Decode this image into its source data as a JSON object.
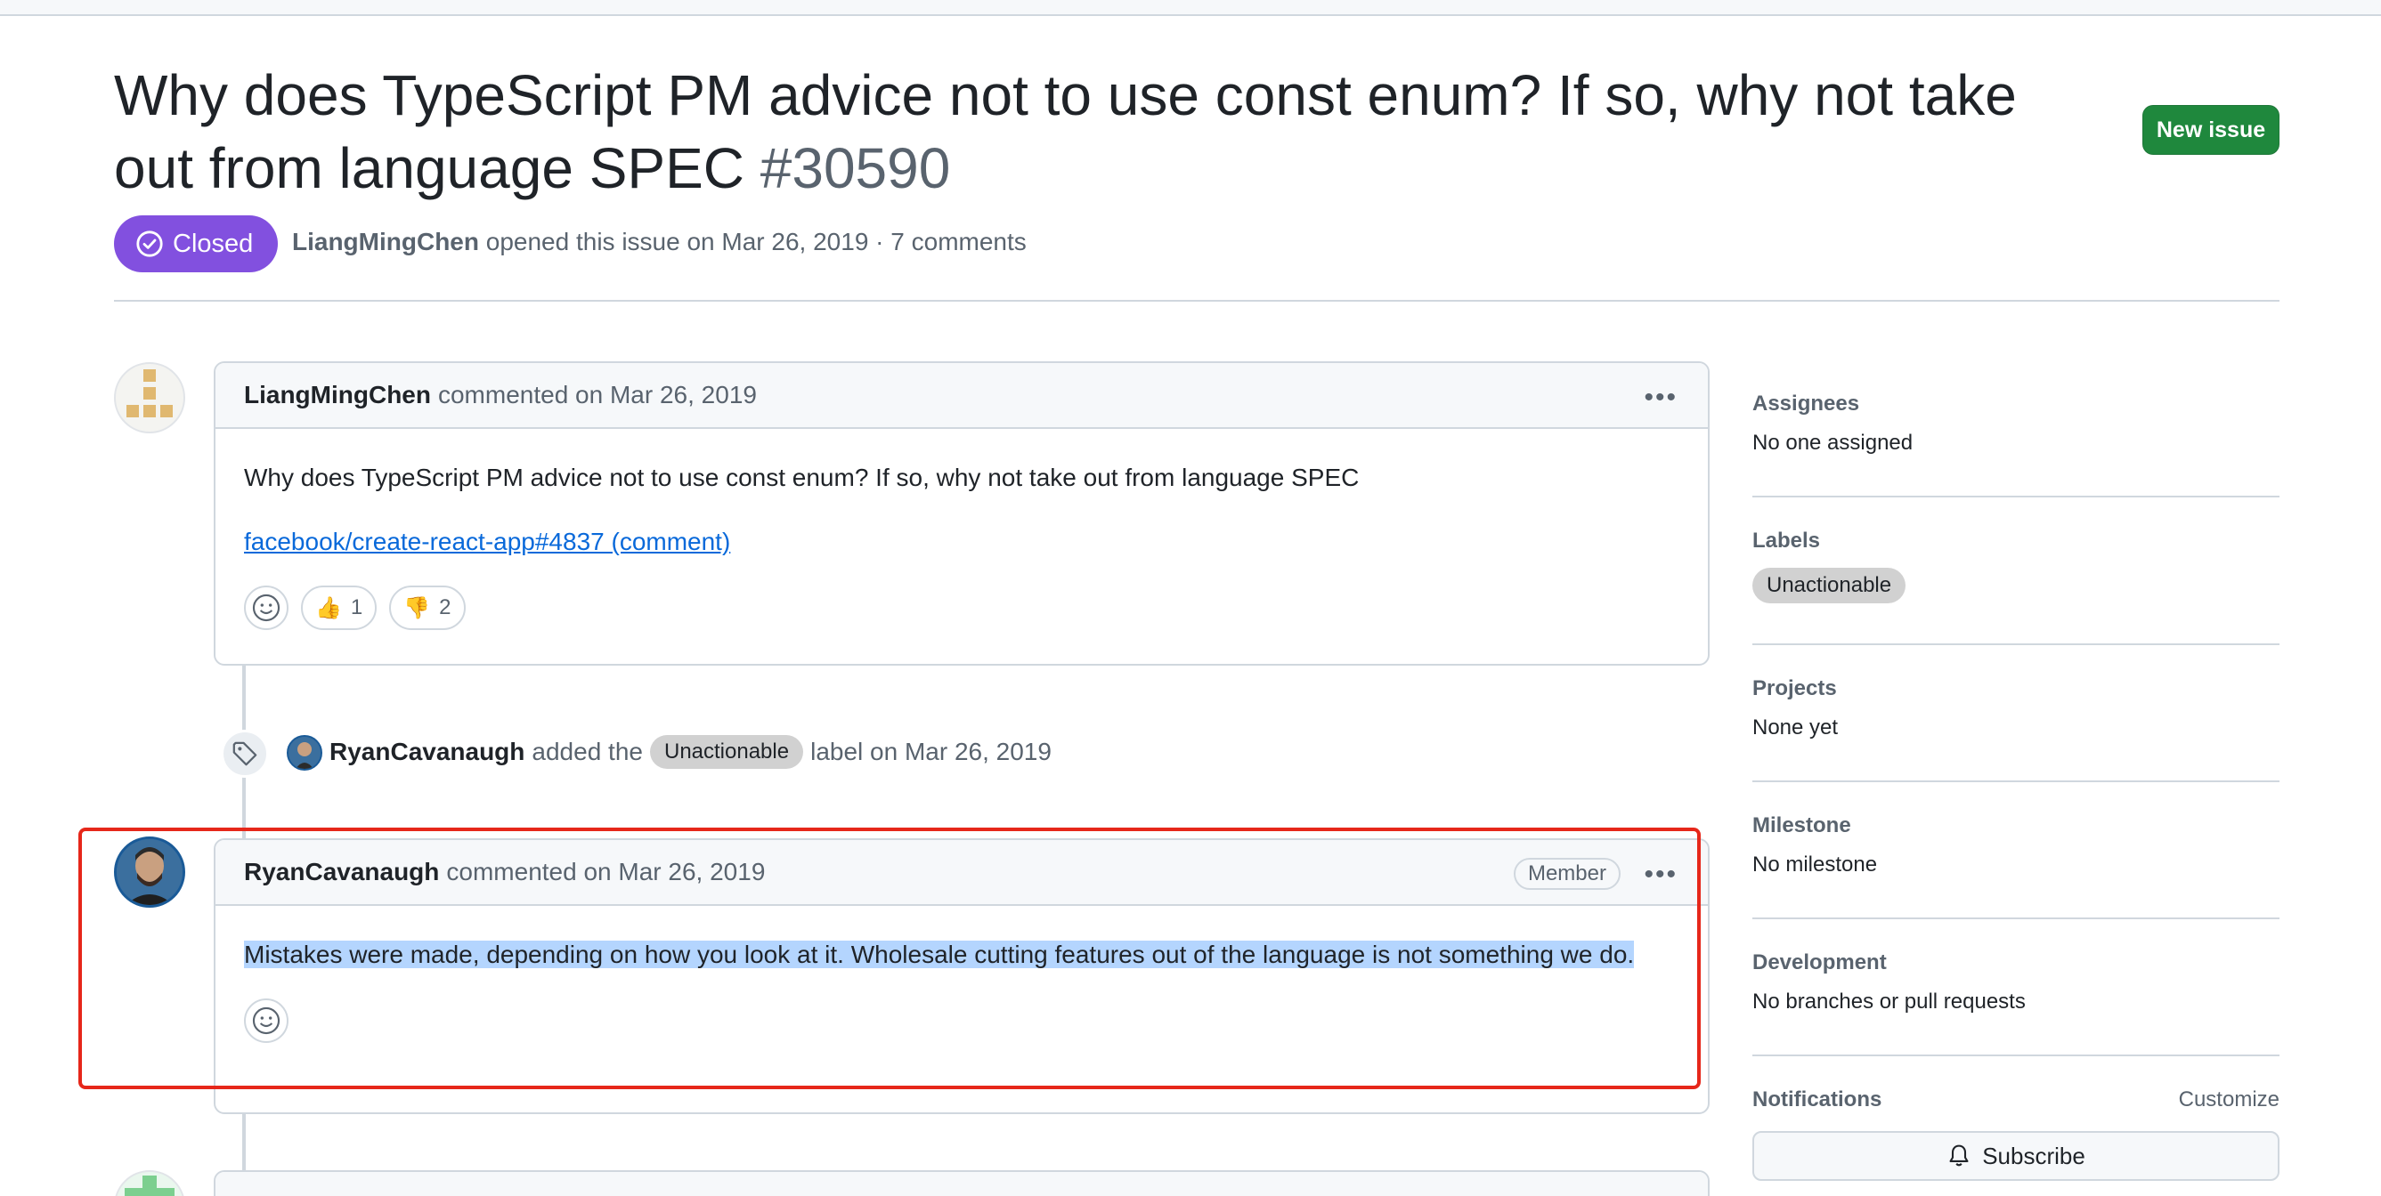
{
  "issue": {
    "title": "Why does TypeScript PM advice not to use const enum? If so, why not take out from language SPEC",
    "number": "#30590",
    "state": "Closed",
    "author": "LiangMingChen",
    "meta_text": "opened this issue on Mar 26, 2019 · 7 comments",
    "new_issue_label": "New issue"
  },
  "comments": [
    {
      "author": "LiangMingChen",
      "date_text": "commented on Mar 26, 2019",
      "body": "Why does TypeScript PM advice not to use const enum? If so, why not take out from language SPEC",
      "link_text": "facebook/create-react-app#4837 (comment)",
      "reactions": [
        {
          "emoji": "👍",
          "count": "1"
        },
        {
          "emoji": "👎",
          "count": "2"
        }
      ]
    },
    {
      "author": "RyanCavanaugh",
      "date_text": "commented on Mar 26, 2019",
      "badge": "Member",
      "body": "Mistakes were made, depending on how you look at it. Wholesale cutting features out of the language is not something we do."
    }
  ],
  "event": {
    "actor": "RyanCavanaugh",
    "text_before": "added the",
    "label": "Unactionable",
    "text_after": "label on Mar 26, 2019"
  },
  "sidebar": {
    "assignees": {
      "title": "Assignees",
      "value": "No one assigned"
    },
    "labels": {
      "title": "Labels",
      "value": "Unactionable"
    },
    "projects": {
      "title": "Projects",
      "value": "None yet"
    },
    "milestone": {
      "title": "Milestone",
      "value": "No milestone"
    },
    "development": {
      "title": "Development",
      "value": "No branches or pull requests"
    },
    "notifications": {
      "title": "Notifications",
      "customize": "Customize",
      "subscribe": "Subscribe"
    }
  },
  "colors": {
    "closed_state": "#8250df",
    "new_issue": "#1f883d",
    "link": "#0969da",
    "highlight_box": "#e6271a",
    "selection": "#b4d5fe"
  },
  "icons": {
    "state": "check-circle-icon",
    "event": "tag-icon",
    "react_add": "smiley-icon",
    "more": "kebab-horizontal-icon",
    "subscribe": "bell-icon"
  }
}
